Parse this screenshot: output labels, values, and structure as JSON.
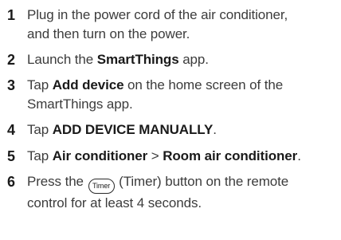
{
  "steps": [
    {
      "number": "1",
      "line1": "Plug in the power cord of the air conditioner,",
      "line2": "and then turn on the power."
    },
    {
      "number": "2",
      "pre": "Launch the ",
      "bold": "SmartThings",
      "post": " app."
    },
    {
      "number": "3",
      "pre": "Tap ",
      "bold": "Add device",
      "post": " on the home screen of the",
      "line2": "SmartThings app."
    },
    {
      "number": "4",
      "pre": "Tap ",
      "bold": "ADD DEVICE MANUALLY",
      "post": "."
    },
    {
      "number": "5",
      "pre": "Tap ",
      "bold1": "Air conditioner",
      "sep": " > ",
      "bold2": "Room air conditioner",
      "post": "."
    },
    {
      "number": "6",
      "pre": "Press the ",
      "icon_label": "Timer",
      "post": " (Timer) button on the remote",
      "line2": "control for at least 4 seconds."
    }
  ]
}
